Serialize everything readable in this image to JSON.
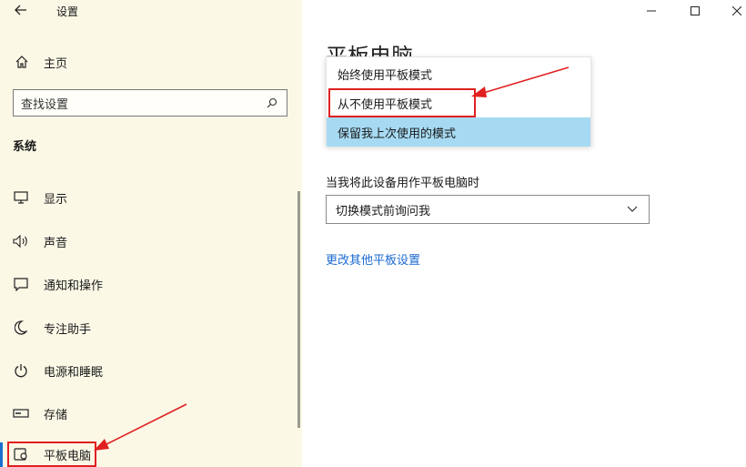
{
  "window": {
    "title": "设置",
    "back_icon": "arrow-left-icon",
    "controls": [
      "minimize-icon",
      "maximize-icon",
      "close-icon"
    ]
  },
  "sidebar": {
    "home_label": "主页",
    "search_placeholder": "查找设置",
    "section_label": "系统",
    "items": [
      {
        "label": "显示",
        "icon": "monitor-icon"
      },
      {
        "label": "声音",
        "icon": "speaker-icon"
      },
      {
        "label": "通知和操作",
        "icon": "message-icon"
      },
      {
        "label": "专注助手",
        "icon": "moon-icon"
      },
      {
        "label": "电源和睡眠",
        "icon": "power-icon"
      },
      {
        "label": "存储",
        "icon": "storage-icon"
      },
      {
        "label": "平板电脑",
        "icon": "tablet-icon",
        "selected": true
      }
    ]
  },
  "main": {
    "heading": "平板电脑",
    "dropdown_options": [
      {
        "label": "始终使用平板模式"
      },
      {
        "label": "从不使用平板模式",
        "annotated": true
      },
      {
        "label": "保留我上次使用的模式",
        "highlighted": true
      }
    ],
    "field_label": "当我将此设备用作平板电脑时",
    "select_value": "切换模式前询问我",
    "link": "更改其他平板设置"
  },
  "colors": {
    "sidebar_bg": "#fbf8e6",
    "accent": "#1c6fd1",
    "highlight": "#a6daf3",
    "annotation_red": "#e02020",
    "link": "#1b6ad1"
  }
}
